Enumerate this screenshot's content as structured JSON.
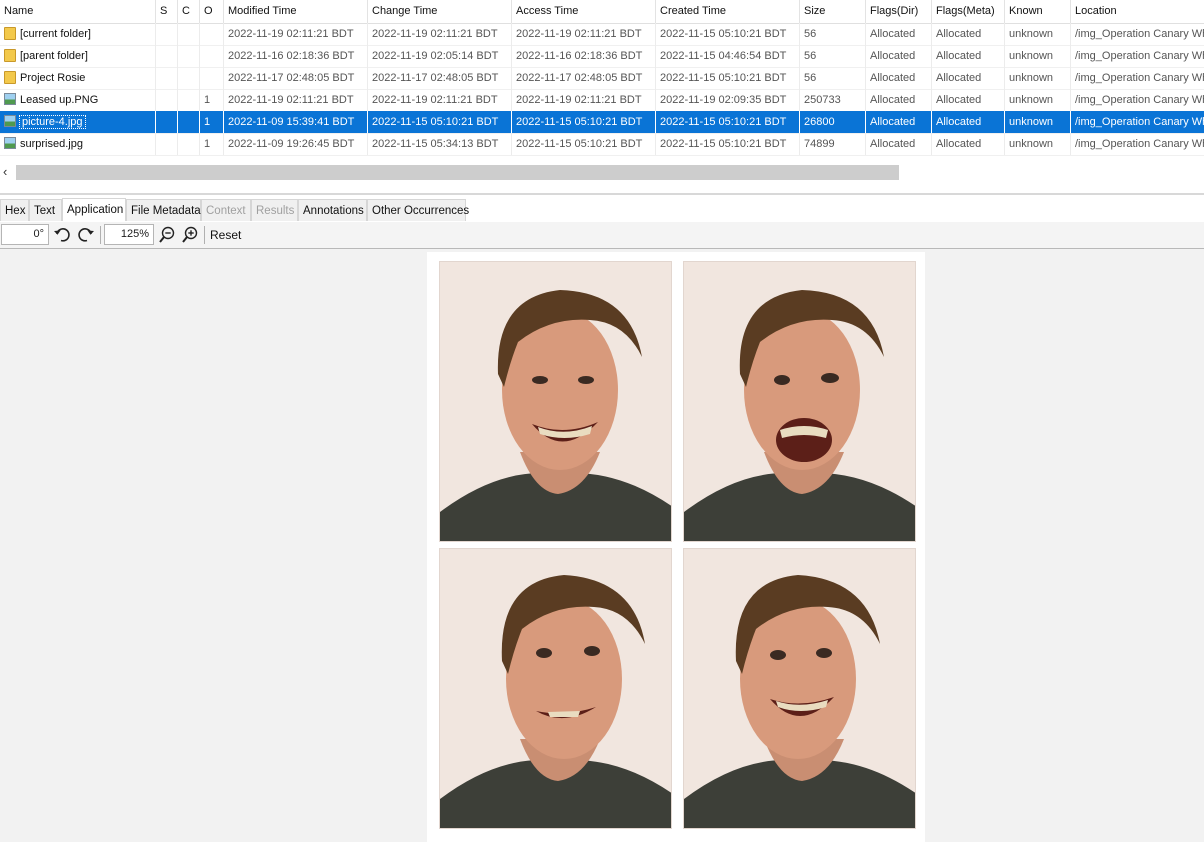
{
  "table": {
    "columns": [
      "Name",
      "S",
      "C",
      "O",
      "Modified Time",
      "Change Time",
      "Access Time",
      "Created Time",
      "Size",
      "Flags(Dir)",
      "Flags(Meta)",
      "Known",
      "Location"
    ],
    "rows": [
      {
        "name": "[current folder]",
        "icon": "folder-icon",
        "o": "",
        "modified": "2022-11-19 02:11:21 BDT",
        "change": "2022-11-19 02:11:21 BDT",
        "access": "2022-11-19 02:11:21 BDT",
        "created": "2022-11-15 05:10:21 BDT",
        "size": "56",
        "flags_dir": "Allocated",
        "flags_meta": "Allocated",
        "known": "unknown",
        "location": "/img_Operation Canary Wh"
      },
      {
        "name": "[parent folder]",
        "icon": "folder-icon",
        "o": "",
        "modified": "2022-11-16 02:18:36 BDT",
        "change": "2022-11-19 02:05:14 BDT",
        "access": "2022-11-16 02:18:36 BDT",
        "created": "2022-11-15 04:46:54 BDT",
        "size": "56",
        "flags_dir": "Allocated",
        "flags_meta": "Allocated",
        "known": "unknown",
        "location": "/img_Operation Canary Wh"
      },
      {
        "name": "Project Rosie",
        "icon": "folder-icon",
        "o": "",
        "modified": "2022-11-17 02:48:05 BDT",
        "change": "2022-11-17 02:48:05 BDT",
        "access": "2022-11-17 02:48:05 BDT",
        "created": "2022-11-15 05:10:21 BDT",
        "size": "56",
        "flags_dir": "Allocated",
        "flags_meta": "Allocated",
        "known": "unknown",
        "location": "/img_Operation Canary Wh"
      },
      {
        "name": "Leased up.PNG",
        "icon": "image-file-icon",
        "o": "1",
        "modified": "2022-11-19 02:11:21 BDT",
        "change": "2022-11-19 02:11:21 BDT",
        "access": "2022-11-19 02:11:21 BDT",
        "created": "2022-11-19 02:09:35 BDT",
        "size": "250733",
        "flags_dir": "Allocated",
        "flags_meta": "Allocated",
        "known": "unknown",
        "location": "/img_Operation Canary Wh"
      },
      {
        "name": "picture-4.jpg",
        "icon": "image-file-icon",
        "o": "1",
        "modified": "2022-11-09 15:39:41 BDT",
        "change": "2022-11-15 05:10:21 BDT",
        "access": "2022-11-15 05:10:21 BDT",
        "created": "2022-11-15 05:10:21 BDT",
        "size": "26800",
        "flags_dir": "Allocated",
        "flags_meta": "Allocated",
        "known": "unknown",
        "location": "/img_Operation Canary Wh",
        "selected": true
      },
      {
        "name": "surprised.jpg",
        "icon": "image-file-icon",
        "o": "1",
        "modified": "2022-11-09 19:26:45 BDT",
        "change": "2022-11-15 05:34:13 BDT",
        "access": "2022-11-15 05:10:21 BDT",
        "created": "2022-11-15 05:10:21 BDT",
        "size": "74899",
        "flags_dir": "Allocated",
        "flags_meta": "Allocated",
        "known": "unknown",
        "location": "/img_Operation Canary Wh"
      }
    ]
  },
  "tabs": [
    {
      "label": "Hex",
      "state": "normal"
    },
    {
      "label": "Text",
      "state": "normal"
    },
    {
      "label": "Application",
      "state": "active"
    },
    {
      "label": "File Metadata",
      "state": "normal"
    },
    {
      "label": "Context",
      "state": "disabled"
    },
    {
      "label": "Results",
      "state": "disabled"
    },
    {
      "label": "Annotations",
      "state": "normal"
    },
    {
      "label": "Other Occurrences",
      "state": "normal"
    }
  ],
  "toolbar": {
    "rotation_value": "0°",
    "zoom_value": "125%",
    "reset_label": "Reset",
    "icons": [
      "rotate-left-icon",
      "rotate-right-icon",
      "zoom-out-icon",
      "zoom-in-icon"
    ]
  },
  "viewer": {
    "image_name": "picture-4.jpg",
    "panels": [
      "grin",
      "laugh",
      "smirk",
      "wide-grin"
    ]
  },
  "colors": {
    "selection": "#0a74d6",
    "folder": "#f3c94b",
    "viewer_bg": "#f2f2f2"
  }
}
